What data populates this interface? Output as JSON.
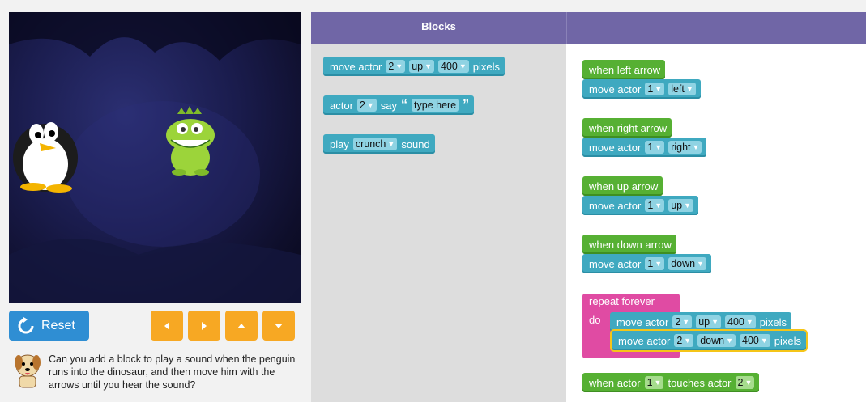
{
  "controls": {
    "reset_label": "Reset",
    "arrow_buttons": [
      "left",
      "right",
      "up",
      "down"
    ]
  },
  "hint": {
    "text": "Can you add a block to play a sound when the penguin runs into the dinosaur, and then move him with the arrows until you hear the sound?"
  },
  "header": {
    "blocks_title": "Blocks"
  },
  "toolbox": {
    "move_actor": {
      "label": "move actor",
      "actor": "2",
      "direction": "up",
      "distance": "400",
      "unit": "pixels"
    },
    "actor_say": {
      "label": "actor",
      "actor": "2",
      "say": "say",
      "open_quote": "“",
      "text": "type here",
      "close_quote": "”"
    },
    "play_sound": {
      "label": "play",
      "sound": "crunch",
      "suffix": "sound"
    }
  },
  "workspace": {
    "events": [
      {
        "when": "when left arrow",
        "move": "move actor",
        "actor": "1",
        "dir": "left"
      },
      {
        "when": "when right arrow",
        "move": "move actor",
        "actor": "1",
        "dir": "right"
      },
      {
        "when": "when up arrow",
        "move": "move actor",
        "actor": "1",
        "dir": "up"
      },
      {
        "when": "when down arrow",
        "move": "move actor",
        "actor": "1",
        "dir": "down"
      }
    ],
    "repeat": {
      "label": "repeat forever",
      "do": "do",
      "stmt1": {
        "move": "move actor",
        "actor": "2",
        "dir": "up",
        "dist": "400",
        "unit": "pixels"
      },
      "stmt2": {
        "move": "move actor",
        "actor": "2",
        "dir": "down",
        "dist": "400",
        "unit": "pixels"
      }
    },
    "touch": {
      "when": "when actor",
      "actor": "1",
      "touches": "touches actor",
      "actor2": "2"
    }
  },
  "colors": {
    "teal": "#3fa9c0",
    "green": "#56b033",
    "pink": "#e04ba3",
    "purple": "#7066a6",
    "orange": "#f7a823",
    "blue": "#2f8ed3"
  }
}
